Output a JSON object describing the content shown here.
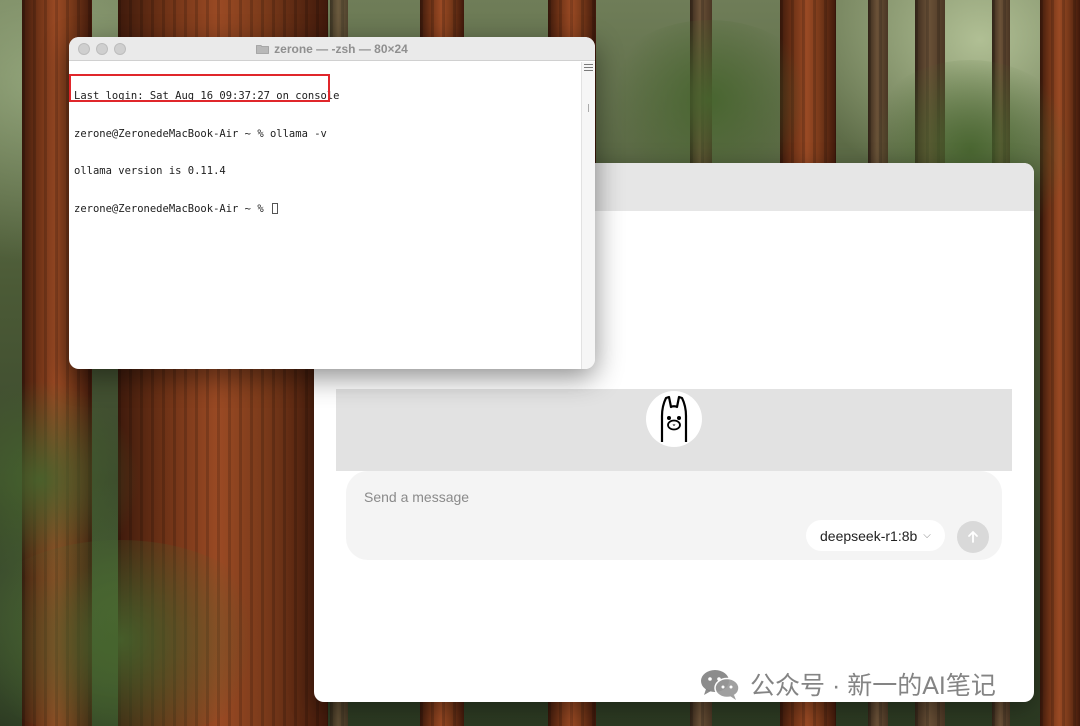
{
  "terminal": {
    "title": "zerone — -zsh — 80×24",
    "lines": [
      "Last login: Sat Aug 16 09:37:27 on console",
      "zerone@ZeronedeMacBook-Air ~ % ollama -v",
      "ollama version is 0.11.4",
      "zerone@ZeronedeMacBook-Air ~ % "
    ]
  },
  "ollama": {
    "logo_icon": "llama-icon",
    "composer_placeholder": "Send a message",
    "model": "deepseek-r1:8b",
    "send_icon": "arrow-up-icon"
  },
  "watermark": {
    "text": "公众号 · 新一的AI笔记",
    "icon": "wechat-icon"
  }
}
